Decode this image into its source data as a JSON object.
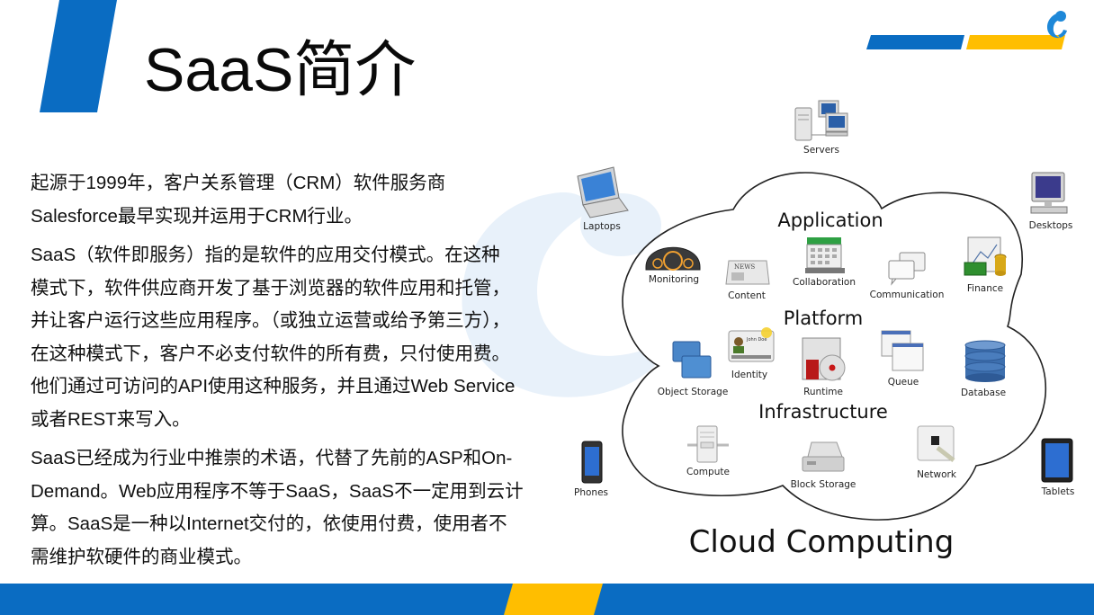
{
  "slide": {
    "title": "SaaS简介",
    "colors": {
      "brand_blue": "#0a6cc2",
      "brand_yellow": "#ffbe00",
      "watermark": "#e8f1fa"
    }
  },
  "body": {
    "paragraphs": [
      {
        "lines": [
          "起源于1999年，客户关系管理（CRM）软件服务商",
          "Salesforce最早实现并运用于CRM行业。"
        ]
      },
      {
        "lines": [
          "SaaS（软件即服务）指的是软件的应用交付模式。在这种",
          "模式下，软件供应商开发了基于浏览器的软件应用和托管，",
          "并让客户运行这些应用程序。（或独立运营或给予第三方），",
          "在这种模式下，客户不必支付软件的所有费，只付使用费。",
          "他们通过可访问的API使用这种服务，并且通过Web Service",
          "或者REST来写入。"
        ]
      },
      {
        "lines": [
          "SaaS已经成为行业中推崇的术语，代替了先前的ASP和On-",
          "Demand。Web应用程序不等于SaaS，SaaS不一定用到云计",
          "算。SaaS是一种以Internet交付的，依使用付费，使用者不",
          "需维护软硬件的商业模式。"
        ]
      }
    ]
  },
  "diagram": {
    "caption": "Cloud Computing",
    "layers": {
      "application": "Application",
      "platform": "Platform",
      "infrastructure": "Infrastructure"
    },
    "clients": {
      "servers": "Servers",
      "laptops": "Laptops",
      "desktops": "Desktops",
      "phones": "Phones",
      "tablets": "Tablets"
    },
    "application_items": {
      "monitoring": "Monitoring",
      "content": "Content",
      "collaboration": "Collaboration",
      "communication": "Communication",
      "finance": "Finance"
    },
    "platform_items": {
      "object_storage": "Object Storage",
      "identity": "Identity",
      "runtime": "Runtime",
      "queue": "Queue",
      "database": "Database"
    },
    "infrastructure_items": {
      "compute": "Compute",
      "block_storage": "Block Storage",
      "network": "Network"
    },
    "identity_card_name": "John Doe",
    "content_icon_text": "NEWS"
  }
}
